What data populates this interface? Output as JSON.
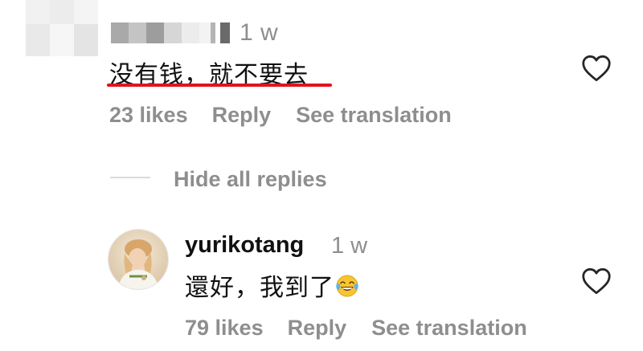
{
  "parent_comment": {
    "username": "",
    "time": "1 w",
    "text": "没有钱，就不要去",
    "likes": "23 likes",
    "reply_label": "Reply",
    "translate_label": "See translation",
    "heart_icon": "heart-outline-icon"
  },
  "replies_toggle": {
    "label": "Hide all replies"
  },
  "reply": {
    "username": "yurikotang",
    "time": "1 w",
    "text": "還好，我到了",
    "emoji": "face-with-tears-of-joy",
    "likes": "79 likes",
    "reply_label": "Reply",
    "translate_label": "See translation",
    "heart_icon": "heart-outline-icon"
  },
  "colors": {
    "primary_text": "#111111",
    "secondary_text": "#8e8e8e",
    "underline": "#e0141e",
    "divider": "#dbdbdb"
  }
}
